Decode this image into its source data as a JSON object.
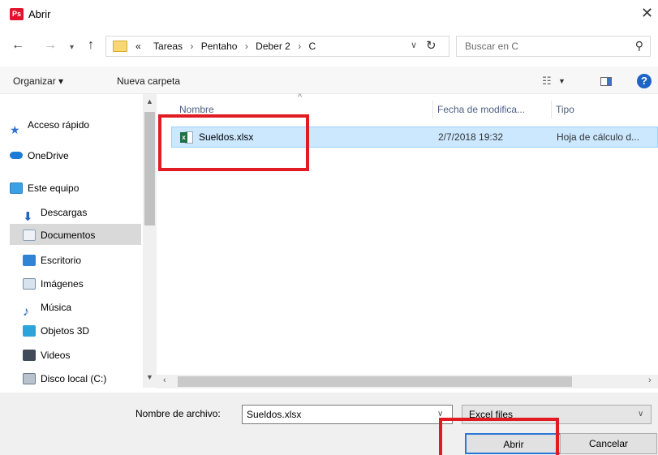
{
  "window": {
    "title": "Abrir",
    "app_icon_text": "Ps",
    "close_glyph": "✕"
  },
  "address": {
    "breadcrumbs": [
      "Tareas",
      "Pentaho",
      "Deber 2",
      "C"
    ],
    "overflow_marker": "«",
    "search_placeholder": "Buscar en C"
  },
  "toolbar": {
    "organize_label": "Organizar ▾",
    "new_folder_label": "Nueva carpeta"
  },
  "sidebar": {
    "items": [
      {
        "label": "Acceso rápido",
        "icon": "star-icon"
      },
      {
        "label": "OneDrive",
        "icon": "cloud-icon"
      },
      {
        "label": "Este equipo",
        "icon": "computer-icon"
      },
      {
        "label": "Descargas",
        "icon": "download-icon"
      },
      {
        "label": "Documentos",
        "icon": "documents-icon",
        "selected": true
      },
      {
        "label": "Escritorio",
        "icon": "desktop-icon"
      },
      {
        "label": "Imágenes",
        "icon": "pictures-icon"
      },
      {
        "label": "Música",
        "icon": "music-icon"
      },
      {
        "label": "Objetos 3D",
        "icon": "objects-3d-icon"
      },
      {
        "label": "Videos",
        "icon": "videos-icon"
      },
      {
        "label": "Disco local (C:)",
        "icon": "disk-icon"
      }
    ]
  },
  "files": {
    "columns": {
      "name": "Nombre",
      "date": "Fecha de modifica...",
      "type": "Tipo"
    },
    "rows": [
      {
        "name": "Sueldos.xlsx",
        "date": "2/7/2018 19:32",
        "type": "Hoja de cálculo d...",
        "selected": true
      }
    ]
  },
  "footer": {
    "filename_label": "Nombre de archivo:",
    "filename_value": "Sueldos.xlsx",
    "filetype_value": "Excel files",
    "open_label": "Abrir",
    "cancel_label": "Cancelar"
  },
  "colors": {
    "annotation_red": "#e01b22",
    "selection_blue": "#cce8ff",
    "accent_blue": "#2b78d4"
  }
}
